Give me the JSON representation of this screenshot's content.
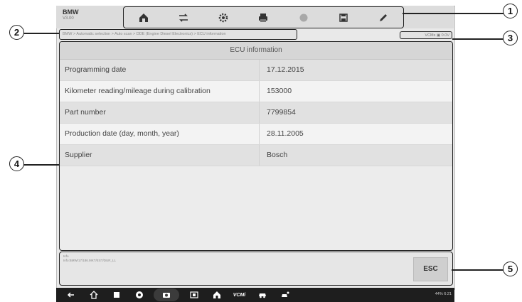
{
  "header": {
    "brand": "BMW",
    "version": "V3.00"
  },
  "toolbar": {
    "icons": [
      "home-icon",
      "vehicle-swap-icon",
      "settings-icon",
      "print-icon",
      "help-icon",
      "save-icon",
      "edit-icon"
    ]
  },
  "breadcrumb": "BMW > Automatic selection > Auto scan > DDE (Engine Diesel Electronics) > ECU information",
  "status": {
    "vcm": "VCMs",
    "voltage": "0.0V"
  },
  "table": {
    "title": "ECU information",
    "rows": [
      {
        "label": "Programming date",
        "value": "17.12.2015"
      },
      {
        "label": "Kilometer reading/mileage during calibration",
        "value": "153000"
      },
      {
        "label": "Part number",
        "value": "7799854"
      },
      {
        "label": "Production date (day, month, year)",
        "value": "28.11.2005"
      },
      {
        "label": "Supplier",
        "value": "Bosch"
      }
    ]
  },
  "bottom": {
    "message_line1": "Info",
    "message_line2": "Info:BMW/17/186.MKT/EST/DUR_LL",
    "esc_label": "ESC"
  },
  "navbar": {
    "status": "44% 6:21"
  },
  "callouts": [
    "1",
    "2",
    "3",
    "4",
    "5"
  ]
}
